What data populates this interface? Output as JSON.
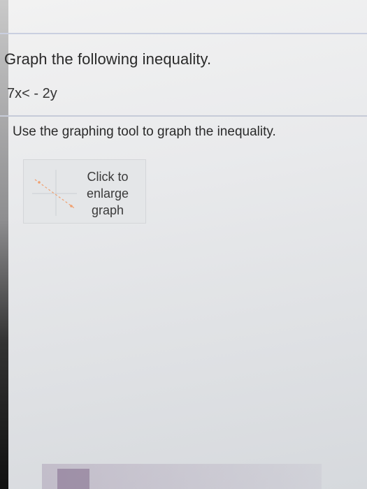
{
  "question": {
    "title": "Graph the following inequality.",
    "expression": "7x< - 2y"
  },
  "instruction": "Use the graphing tool to graph the inequality.",
  "graph_thumbnail": {
    "label": "Click to\nenlarge\ngraph"
  },
  "colors": {
    "rule": "#c9cfe0",
    "thumbnail_line": "#f0a070"
  }
}
